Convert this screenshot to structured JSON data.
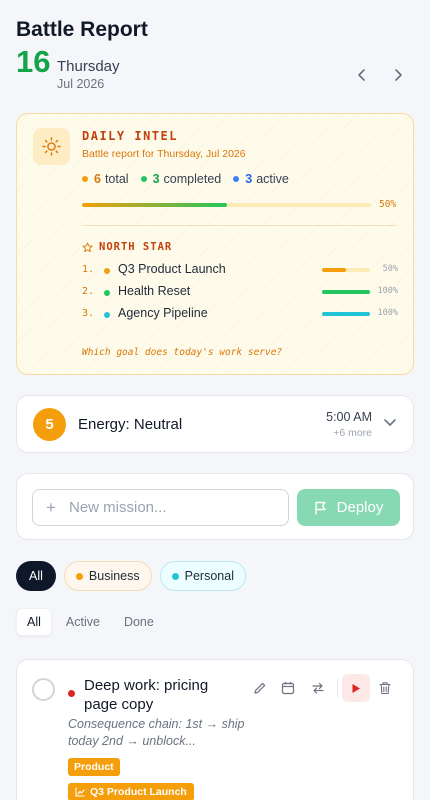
{
  "header": {
    "title": "Battle Report",
    "day_number": "16",
    "weekday": "Thursday",
    "month_year": "Jul 2026",
    "prev_icon": "chevron-left-icon",
    "next_icon": "chevron-right-icon"
  },
  "intel": {
    "icon": "sun-icon",
    "title": "DAILY INTEL",
    "subtitle": "Battle report for Thursday, Jul 2026",
    "stats": [
      {
        "value": "6",
        "label": "total",
        "color": "#f59e0b"
      },
      {
        "value": "3",
        "label": "completed",
        "color": "#22c55e"
      },
      {
        "value": "3",
        "label": "active",
        "color": "#3b82f6"
      }
    ],
    "progress": 0.5,
    "progress_label": "50%",
    "north_star": {
      "icon": "star-icon",
      "title": "NORTH STAR",
      "goals": [
        {
          "num": "1.",
          "name": "Q3 Product Launch",
          "color": "#f59e0b",
          "progress": 0.5,
          "pct": "50%"
        },
        {
          "num": "2.",
          "name": "Health Reset",
          "color": "#22c55e",
          "progress": 1.0,
          "pct": "100%"
        },
        {
          "num": "3.",
          "name": "Agency Pipeline",
          "color": "#22c3d6",
          "progress": 1.0,
          "pct": "100%"
        }
      ]
    },
    "question": "Which goal does today's work serve?"
  },
  "energy": {
    "level": "5",
    "label": "Energy: Neutral",
    "time": "5:00 AM",
    "more": "+6 more",
    "chevron_icon": "chevron-down-icon"
  },
  "mission": {
    "placeholder": "New mission...",
    "deploy_label": "Deploy",
    "plus_icon": "plus-icon",
    "flag_icon": "flag-icon"
  },
  "filters": {
    "categories": [
      {
        "label": "All",
        "selected": true
      },
      {
        "label": "Business",
        "color": "#f59e0b"
      },
      {
        "label": "Personal",
        "color": "#22c3d6"
      }
    ],
    "tabs": [
      {
        "label": "All",
        "selected": true
      },
      {
        "label": "Active"
      },
      {
        "label": "Done"
      }
    ]
  },
  "tasks": [
    {
      "title": "Deep work: pricing page copy",
      "description": "Consequence chain: 1st → ship today 2nd → unblock...",
      "priority_color": "#dc2626",
      "tags": [
        "Product",
        "Q3 Product Launch"
      ],
      "actions": [
        "edit-icon",
        "calendar-icon",
        "swap-icon",
        "play-icon",
        "trash-icon"
      ]
    }
  ]
}
